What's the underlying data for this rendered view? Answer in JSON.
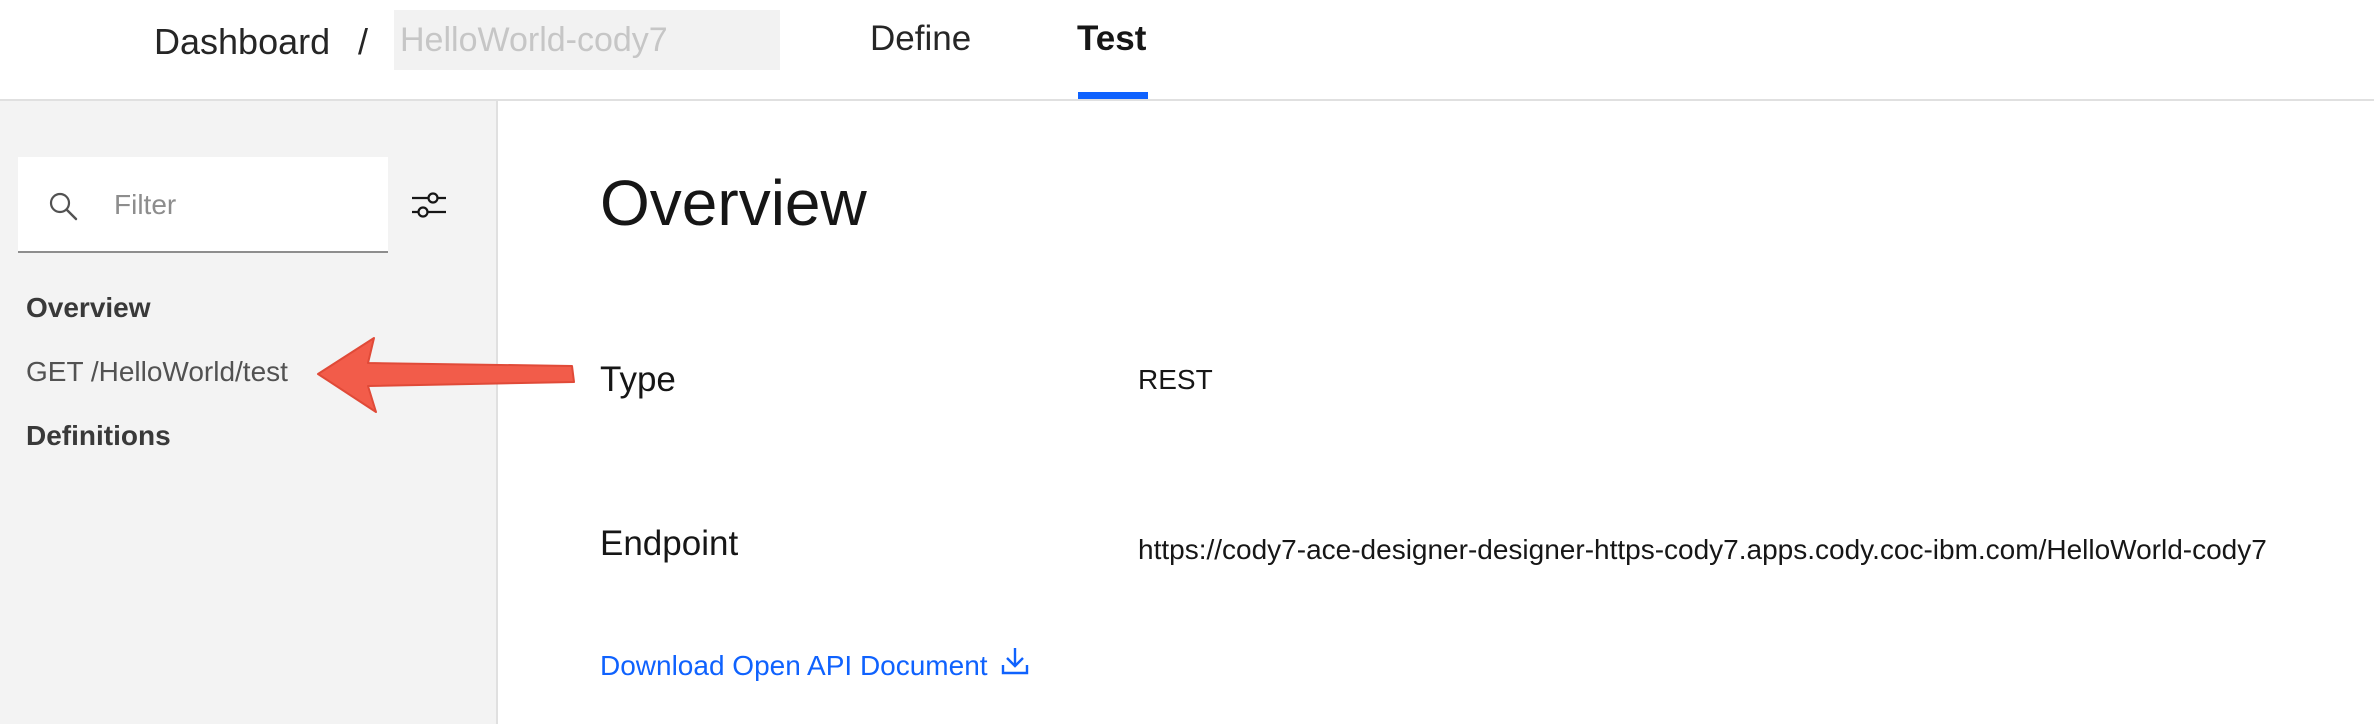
{
  "header": {
    "breadcrumb_root": "Dashboard",
    "breadcrumb_separator": "/",
    "api_name_placeholder": "HelloWorld-cody7",
    "tabs": [
      {
        "label": "Define",
        "active": false
      },
      {
        "label": "Test",
        "active": true
      }
    ],
    "accent_color": "#0f62fe"
  },
  "sidebar": {
    "filter_placeholder": "Filter",
    "filter_icon": "search-icon",
    "settings_icon": "sliders-icon",
    "items": [
      {
        "label": "Overview",
        "bold": true
      },
      {
        "label": "GET /HelloWorld/test",
        "bold": false
      },
      {
        "label": "Definitions",
        "bold": true
      }
    ]
  },
  "annotation": {
    "type": "arrow",
    "color": "#f25c4a",
    "points_to": "GET /HelloWorld/test"
  },
  "main": {
    "title": "Overview",
    "fields": {
      "type_label": "Type",
      "type_value": "REST",
      "endpoint_label": "Endpoint",
      "endpoint_value": "https://cody7-ace-designer-designer-https-cody7.apps.cody.coc-ibm.com/HelloWorld-cody7"
    },
    "download_link": "Download Open API Document",
    "download_icon": "download-icon",
    "link_color": "#0f62fe"
  }
}
